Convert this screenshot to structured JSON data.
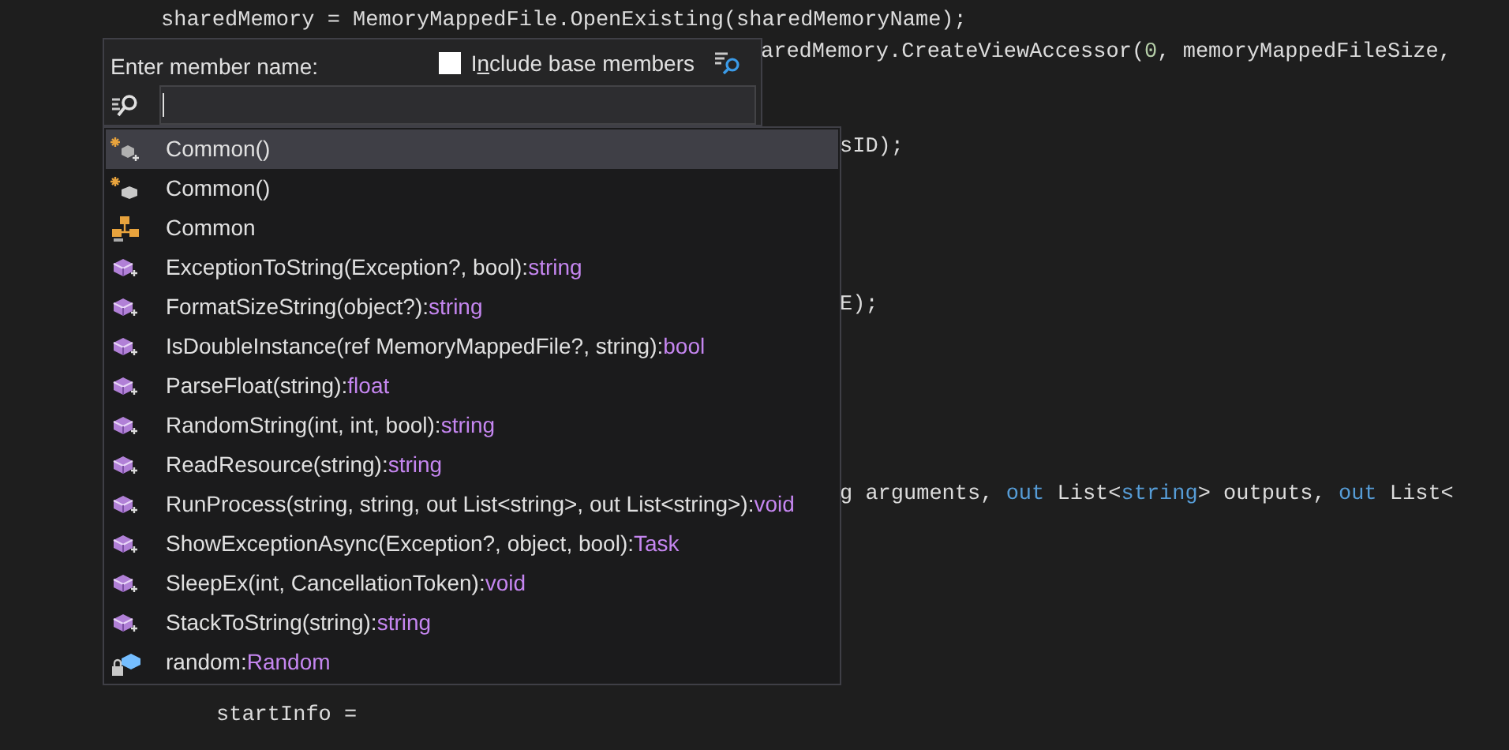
{
  "code_lines": [
    {
      "tokens": [
        {
          "text": "sharedMemory = MemoryMappedFile.OpenExisting(sharedMemoryName);",
          "kind": "plain"
        }
      ]
    },
    {
      "tokens": [
        {
          "text": "aredMemory.CreateViewAccessor(",
          "kind": "plain"
        },
        {
          "text": "0",
          "kind": "number"
        },
        {
          "text": ", memoryMappedFileSize,",
          "kind": "plain"
        }
      ]
    },
    {
      "tokens": [
        {
          "text": "sID);",
          "kind": "plain"
        }
      ]
    },
    {
      "tokens": [
        {
          "text": "E);",
          "kind": "plain"
        }
      ]
    },
    {
      "tokens": [
        {
          "text": "g arguments, ",
          "kind": "plain"
        },
        {
          "text": "out",
          "kind": "keyword"
        },
        {
          "text": " List<",
          "kind": "plain"
        },
        {
          "text": "string",
          "kind": "keyword"
        },
        {
          "text": "> outputs, ",
          "kind": "plain"
        },
        {
          "text": "out",
          "kind": "keyword"
        },
        {
          "text": " List<",
          "kind": "plain"
        }
      ]
    },
    {
      "tokens": [
        {
          "text": "startInfo =",
          "kind": "plain"
        }
      ]
    }
  ],
  "member_popup": {
    "label": "Enter member name:",
    "include_base_members": {
      "label_before": "I",
      "access_key": "n",
      "label_after": "clude base members",
      "checked": false
    },
    "members": [
      {
        "kind": "constructor",
        "name": "Common()",
        "selected": true
      },
      {
        "kind": "static_constructor",
        "name": "Common()",
        "selected": false
      },
      {
        "kind": "class",
        "name": "Common",
        "selected": false
      },
      {
        "kind": "method",
        "name": "ExceptionToString(Exception?, bool):",
        "return_type": "string",
        "selected": false
      },
      {
        "kind": "method",
        "name": "FormatSizeString(object?):",
        "return_type": "string",
        "selected": false
      },
      {
        "kind": "method",
        "name": "IsDoubleInstance(ref MemoryMappedFile?, string):",
        "return_type": "bool",
        "selected": false
      },
      {
        "kind": "method",
        "name": "ParseFloat(string):",
        "return_type": "float",
        "selected": false
      },
      {
        "kind": "method",
        "name": "RandomString(int, int, bool):",
        "return_type": "string",
        "selected": false
      },
      {
        "kind": "method",
        "name": "ReadResource(string):",
        "return_type": "string",
        "selected": false
      },
      {
        "kind": "method",
        "name": "RunProcess(string, string, out List<string>, out List<string>):",
        "return_type": "void",
        "selected": false
      },
      {
        "kind": "method",
        "name": "ShowExceptionAsync(Exception?, object, bool):",
        "return_type": "Task",
        "selected": false
      },
      {
        "kind": "method",
        "name": "SleepEx(int, CancellationToken):",
        "return_type": "void",
        "selected": false
      },
      {
        "kind": "method",
        "name": "StackToString(string):",
        "return_type": "string",
        "selected": false
      },
      {
        "kind": "private_field",
        "name": "random:",
        "return_type": "Random",
        "selected": false
      }
    ]
  }
}
